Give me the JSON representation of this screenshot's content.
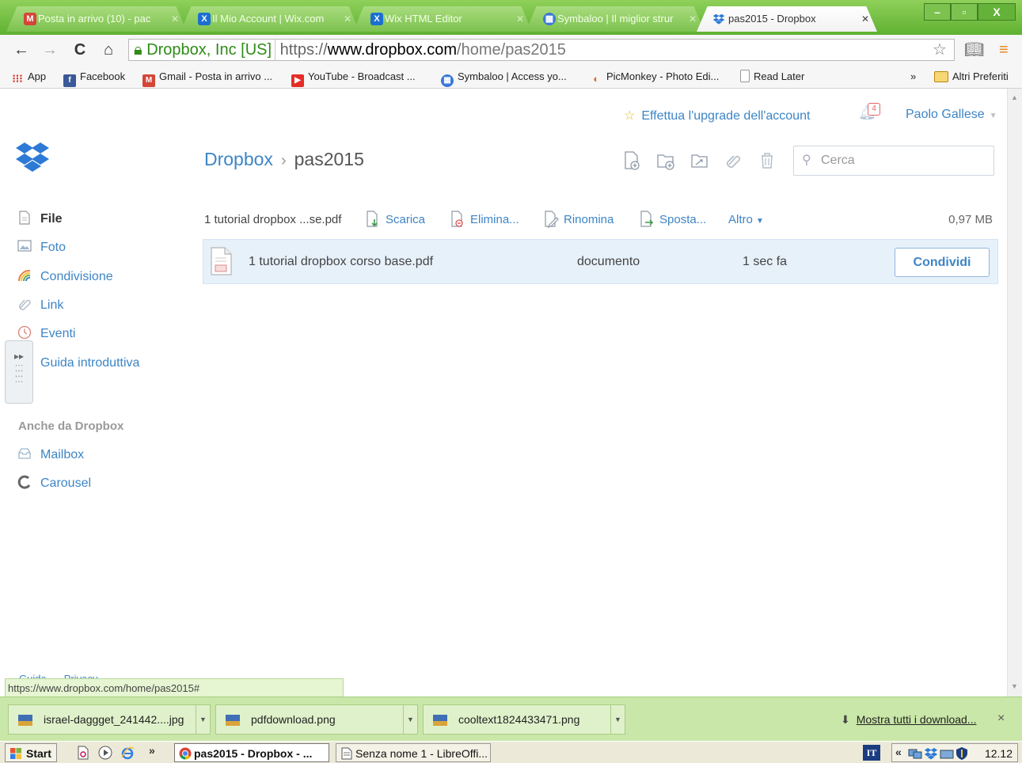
{
  "browser": {
    "tabs": [
      {
        "title": "Posta in arrivo (10) - pac",
        "favicon": "gmail-icon",
        "active": false
      },
      {
        "title": "Il Mio Account | Wix.com",
        "favicon": "wix-icon",
        "active": false
      },
      {
        "title": "Wix HTML Editor",
        "favicon": "wix-icon",
        "active": false
      },
      {
        "title": "Symbaloo | Il miglior strur",
        "favicon": "symbaloo-icon",
        "active": false
      },
      {
        "title": "pas2015 - Dropbox",
        "favicon": "dropbox-icon",
        "active": true
      }
    ],
    "omnibox": {
      "ev_label": "Dropbox, Inc [US]",
      "scheme": "https://",
      "host": "www.dropbox.com",
      "path": "/home/pas2015"
    },
    "bookmarks": [
      {
        "label": "App",
        "icon": "apps-grid-icon"
      },
      {
        "label": "Facebook",
        "icon": "facebook-icon"
      },
      {
        "label": "Gmail - Posta in arrivo ...",
        "icon": "gmail-icon"
      },
      {
        "label": "YouTube - Broadcast ...",
        "icon": "youtube-icon"
      },
      {
        "label": "Symbaloo | Access yo...",
        "icon": "symbaloo-icon"
      },
      {
        "label": "PicMonkey - Photo Edi...",
        "icon": "picmonkey-icon"
      },
      {
        "label": "Read Later",
        "icon": "page-icon"
      }
    ],
    "bookmarks_overflow": "»",
    "other_bookmarks": "Altri Preferiti",
    "status_url": "https://www.dropbox.com/home/pas2015#"
  },
  "header": {
    "upgrade_label": "Effettua l'upgrade dell'account",
    "notification_count": "4",
    "user_name": "Paolo Gallese"
  },
  "breadcrumb": {
    "root": "Dropbox",
    "separator": "›",
    "current": "pas2015"
  },
  "search": {
    "placeholder": "Cerca"
  },
  "sidebar": {
    "items": [
      {
        "label": "File",
        "icon": "file-icon",
        "active": true
      },
      {
        "label": "Foto",
        "icon": "photo-icon",
        "active": false
      },
      {
        "label": "Condivisione",
        "icon": "sharing-icon",
        "active": false
      },
      {
        "label": "Link",
        "icon": "link-icon",
        "active": false
      },
      {
        "label": "Eventi",
        "icon": "events-icon",
        "active": false
      },
      {
        "label": "Guida introduttiva",
        "icon": "guide-icon",
        "active": false
      }
    ],
    "also_heading": "Anche da Dropbox",
    "also_items": [
      {
        "label": "Mailbox",
        "icon": "mailbox-icon"
      },
      {
        "label": "Carousel",
        "icon": "carousel-icon"
      }
    ]
  },
  "actions": {
    "selected_name": "1 tutorial dropbox ...se.pdf",
    "download": "Scarica",
    "delete": "Elimina...",
    "rename": "Rinomina",
    "move": "Sposta...",
    "more": "Altro",
    "size": "0,97 MB"
  },
  "files": [
    {
      "name": "1 tutorial dropbox corso base.pdf",
      "kind": "documento",
      "modified": "1 sec fa",
      "share_label": "Condividi"
    }
  ],
  "footer": {
    "links": [
      "Guida",
      "Privacy",
      "..."
    ]
  },
  "downloads": {
    "items": [
      {
        "name": "israel-daggget_241442....jpg"
      },
      {
        "name": "pdfdownload.png"
      },
      {
        "name": "cooltext1824433471.png"
      }
    ],
    "show_all": "Mostra tutti i download...",
    "close": "×"
  },
  "taskbar": {
    "start_label": "Start",
    "more": "»",
    "tasks": [
      {
        "label": "pas2015 - Dropbox - ...",
        "active": true
      },
      {
        "label": "Senza nome 1 - LibreOffi...",
        "active": false
      }
    ],
    "language": "IT",
    "tray_more": "«",
    "clock": "12.12"
  },
  "colors": {
    "accent": "#3d85c6",
    "chrome_theme": "#7cc24f",
    "selected_row": "#e7f1fa",
    "shelf": "#c9e7a8"
  }
}
